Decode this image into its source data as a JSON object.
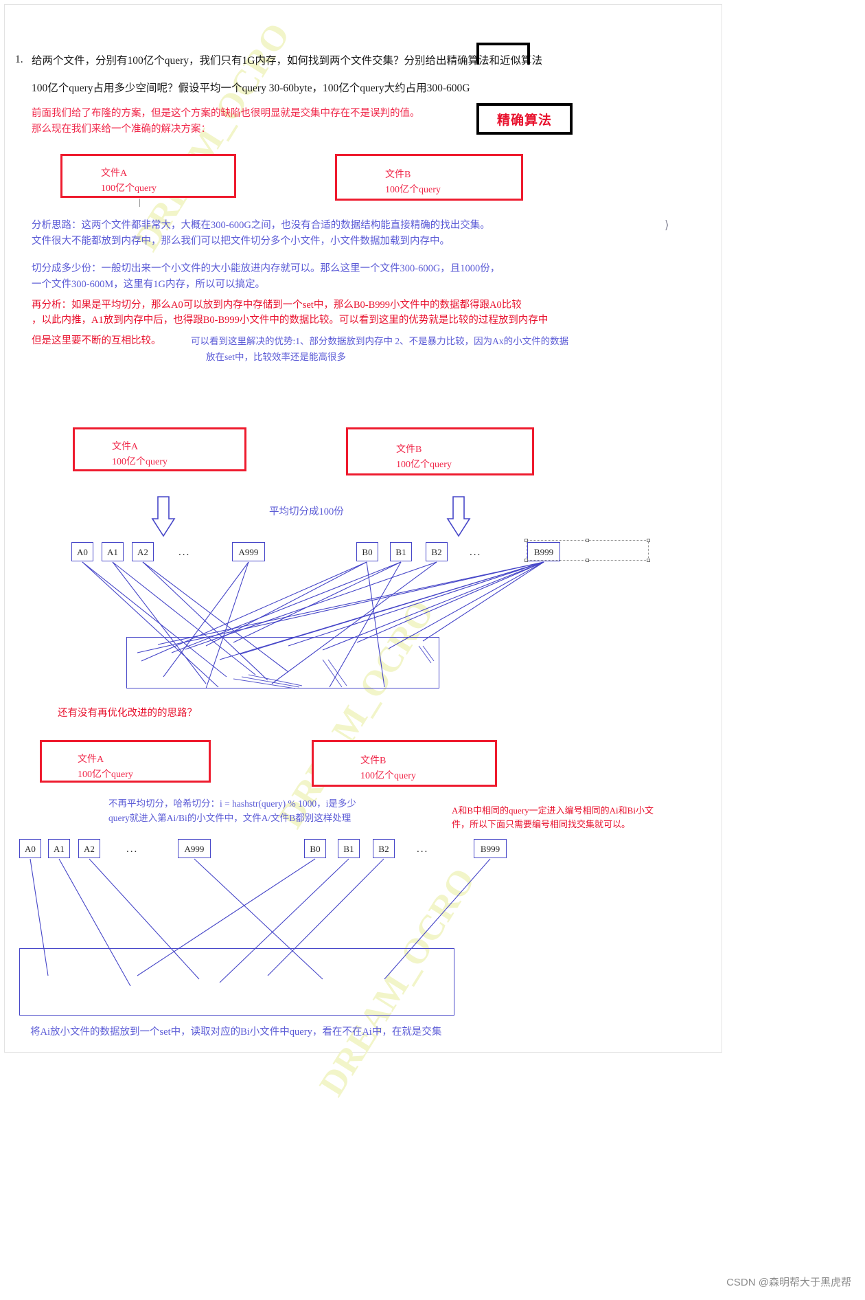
{
  "document": {
    "list_number": "1.",
    "question": "给两个文件，分别有100亿个query，我们只有1G内存，如何找到两个文件交集？分别给出精确算法和近似算法",
    "space_line": "100亿个query占用多少空间呢？假设平均一个query 30-60byte，100亿个query大约占用300-600G",
    "bloom_note_line1": "前面我们给了布隆的方案，但是这个方案的缺陷也很明显就是交集中存在不是误判的值。",
    "bloom_note_line2": "那么现在我们来给一个准确的解决方案：",
    "exact_algo_badge": "精确算法",
    "analysis": {
      "line1": "分析思路：这两个文件都非常大，大概在300-600G之间，也没有合适的数据结构能直接精确的找出交集。",
      "line2": "文件很大不能都放到内存中，那么我们可以把文件切分多个小文件，小文件数据加载到内存中。",
      "line3": "切分成多少份：一般切出来一个小文件的大小能放进内存就可以。那么这里一个文件300-600G，且1000份，",
      "line4": "一个文件300-600M，这里有1G内存，所以可以搞定。"
    },
    "reanalysis": {
      "line1": "再分析：如果是平均切分，那么A0可以放到内存中存储到一个set中，那么B0-B999小文件中的数据都得跟A0比较",
      "line2": "，以此内推，A1放到内存中后，也得跟B0-B999小文件中的数据比较。可以看到这里的优势就是比较的过程放到内存中",
      "line3": "但是这里要不断的互相比较。"
    },
    "advantage": {
      "line1": "可以看到这里解决的优势:1、部分数据放到内存中 2、不是暴力比较，因为Ax的小文件的数据",
      "line2": "放在set中，比较效率还是能高很多"
    },
    "improve_question": "还有没有再优化改进的的思路？",
    "hash_split": {
      "line1": "不再平均切分，哈希切分：i = hashstr(query) % 1000，i是多少",
      "line2": "query就进入第Ai/Bi的小文件中，文件A/文件B都别这样处理"
    },
    "hash_note": {
      "line1": "A和B中相同的query一定进入编号相同的Ai和Bi小文",
      "line2": "件，所以下面只需要编号相同找交集就可以。"
    },
    "bottom_caption": "将Ai放小文件的数据放到一个set中，读取对应的Bi小文件中query，看在不在Ai中，在就是交集"
  },
  "file_boxes": {
    "top": [
      {
        "title": "文件A",
        "subtitle": "100亿个query"
      },
      {
        "title": "文件B",
        "subtitle": "100亿个query"
      }
    ],
    "middle": [
      {
        "title": "文件A",
        "subtitle": "100亿个query"
      },
      {
        "title": "文件B",
        "subtitle": "100亿个query"
      }
    ],
    "bottom": [
      {
        "title": "文件A",
        "subtitle": "100亿个query"
      },
      {
        "title": "文件B",
        "subtitle": "100亿个query"
      }
    ]
  },
  "split_label": "平均切分成100份",
  "chips_row1": [
    {
      "label": "A0"
    },
    {
      "label": "A1"
    },
    {
      "label": "A2"
    },
    {
      "label": "..."
    },
    {
      "label": "A999"
    },
    {
      "label": "B0"
    },
    {
      "label": "B1"
    },
    {
      "label": "B2"
    },
    {
      "label": "..."
    },
    {
      "label": "B999"
    }
  ],
  "chips_row2": [
    {
      "label": "A0"
    },
    {
      "label": "A1"
    },
    {
      "label": "A2"
    },
    {
      "label": "..."
    },
    {
      "label": "A999"
    },
    {
      "label": "B0"
    },
    {
      "label": "B1"
    },
    {
      "label": "B2"
    },
    {
      "label": "..."
    },
    {
      "label": "B999"
    }
  ],
  "watermarks": [
    {
      "text": "DREAM_OCRO"
    },
    {
      "text": "DREAM_OCRO"
    },
    {
      "text": "DREAM_OCRO"
    }
  ],
  "footer": "CSDN @森明帮大于黑虎帮",
  "colors": {
    "red": "#ee1b2e",
    "red_text": "#f0284a",
    "blue": "#5b5bd6",
    "blue_line": "#4646c8",
    "black": "#000000",
    "footer_gray": "#8c8c8c"
  }
}
